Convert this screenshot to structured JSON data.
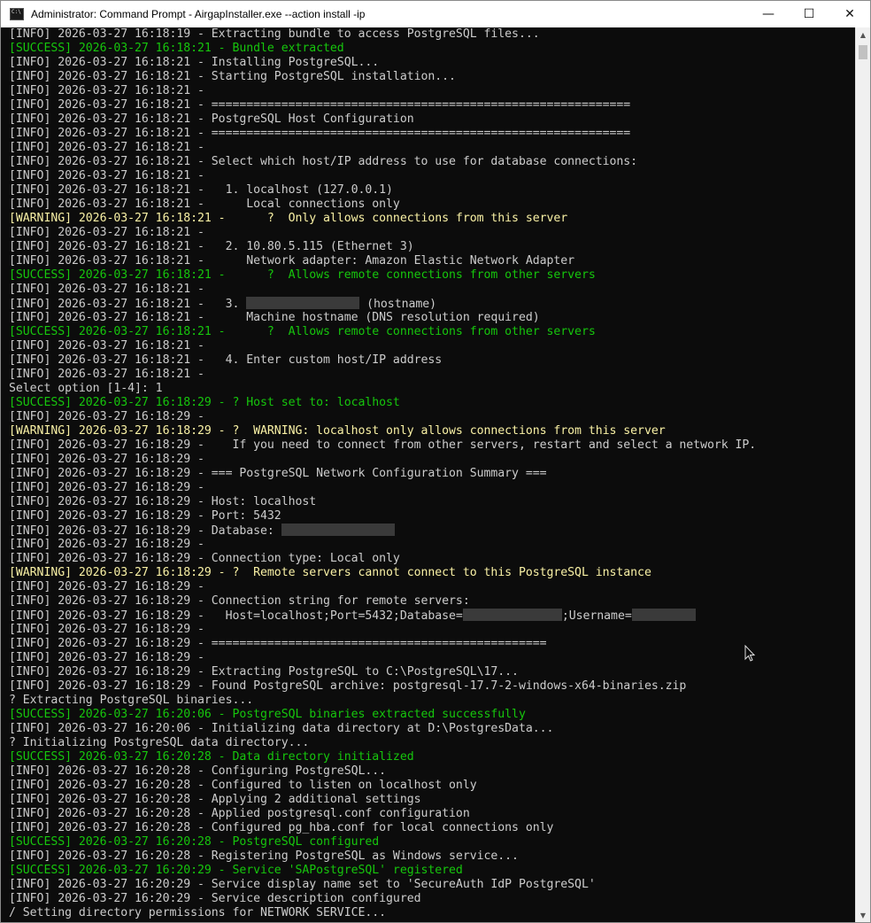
{
  "window": {
    "title": "Administrator: Command Prompt - AirgapInstaller.exe  --action install -ip",
    "controls": {
      "minimize": "—",
      "maximize": "☐",
      "close": "✕"
    }
  },
  "console": {
    "lines": [
      {
        "type": "info",
        "text": "[INFO] 2026-03-27 16:18:19 - Extracting bundle to access PostgreSQL files..."
      },
      {
        "type": "success",
        "text": "[SUCCESS] 2026-03-27 16:18:21 - Bundle extracted"
      },
      {
        "type": "info",
        "text": "[INFO] 2026-03-27 16:18:21 - Installing PostgreSQL..."
      },
      {
        "type": "info",
        "text": "[INFO] 2026-03-27 16:18:21 - Starting PostgreSQL installation..."
      },
      {
        "type": "info",
        "text": "[INFO] 2026-03-27 16:18:21 -"
      },
      {
        "type": "info",
        "text": "[INFO] 2026-03-27 16:18:21 - ============================================================"
      },
      {
        "type": "info",
        "text": "[INFO] 2026-03-27 16:18:21 - PostgreSQL Host Configuration"
      },
      {
        "type": "info",
        "text": "[INFO] 2026-03-27 16:18:21 - ============================================================"
      },
      {
        "type": "info",
        "text": "[INFO] 2026-03-27 16:18:21 -"
      },
      {
        "type": "info",
        "text": "[INFO] 2026-03-27 16:18:21 - Select which host/IP address to use for database connections:"
      },
      {
        "type": "info",
        "text": "[INFO] 2026-03-27 16:18:21 -"
      },
      {
        "type": "info",
        "text": "[INFO] 2026-03-27 16:18:21 -   1. localhost (127.0.0.1)"
      },
      {
        "type": "info",
        "text": "[INFO] 2026-03-27 16:18:21 -      Local connections only"
      },
      {
        "type": "warning",
        "text": "[WARNING] 2026-03-27 16:18:21 -      ?  Only allows connections from this server"
      },
      {
        "type": "info",
        "text": "[INFO] 2026-03-27 16:18:21 -"
      },
      {
        "type": "info",
        "text": "[INFO] 2026-03-27 16:18:21 -   2. 10.80.5.115 (Ethernet 3)"
      },
      {
        "type": "info",
        "text": "[INFO] 2026-03-27 16:18:21 -      Network adapter: Amazon Elastic Network Adapter"
      },
      {
        "type": "success",
        "text": "[SUCCESS] 2026-03-27 16:18:21 -      ?  Allows remote connections from other servers"
      },
      {
        "type": "info",
        "text": "[INFO] 2026-03-27 16:18:21 -"
      },
      {
        "type": "info",
        "text": "[INFO] 2026-03-27 16:18:21 -   3. ",
        "redact": 16,
        "after": " (hostname)"
      },
      {
        "type": "info",
        "text": "[INFO] 2026-03-27 16:18:21 -      Machine hostname (DNS resolution required)"
      },
      {
        "type": "success",
        "text": "[SUCCESS] 2026-03-27 16:18:21 -      ?  Allows remote connections from other servers"
      },
      {
        "type": "info",
        "text": "[INFO] 2026-03-27 16:18:21 -"
      },
      {
        "type": "info",
        "text": "[INFO] 2026-03-27 16:18:21 -   4. Enter custom host/IP address"
      },
      {
        "type": "info",
        "text": "[INFO] 2026-03-27 16:18:21 -"
      },
      {
        "type": "info",
        "text": "Select option [1-4]: 1"
      },
      {
        "type": "success",
        "text": "[SUCCESS] 2026-03-27 16:18:29 - ? Host set to: localhost"
      },
      {
        "type": "info",
        "text": "[INFO] 2026-03-27 16:18:29 -"
      },
      {
        "type": "warning",
        "text": "[WARNING] 2026-03-27 16:18:29 - ?  WARNING: localhost only allows connections from this server"
      },
      {
        "type": "info",
        "text": "[INFO] 2026-03-27 16:18:29 -    If you need to connect from other servers, restart and select a network IP."
      },
      {
        "type": "info",
        "text": "[INFO] 2026-03-27 16:18:29 -"
      },
      {
        "type": "info",
        "text": "[INFO] 2026-03-27 16:18:29 - === PostgreSQL Network Configuration Summary ==="
      },
      {
        "type": "info",
        "text": "[INFO] 2026-03-27 16:18:29 -"
      },
      {
        "type": "info",
        "text": "[INFO] 2026-03-27 16:18:29 - Host: localhost"
      },
      {
        "type": "info",
        "text": "[INFO] 2026-03-27 16:18:29 - Port: 5432"
      },
      {
        "type": "info",
        "text": "[INFO] 2026-03-27 16:18:29 - Database: ",
        "redact": 16,
        "after": ""
      },
      {
        "type": "info",
        "text": "[INFO] 2026-03-27 16:18:29 -"
      },
      {
        "type": "info",
        "text": "[INFO] 2026-03-27 16:18:29 - Connection type: Local only"
      },
      {
        "type": "warning",
        "text": "[WARNING] 2026-03-27 16:18:29 - ?  Remote servers cannot connect to this PostgreSQL instance"
      },
      {
        "type": "info",
        "text": "[INFO] 2026-03-27 16:18:29 -"
      },
      {
        "type": "info",
        "text": "[INFO] 2026-03-27 16:18:29 - Connection string for remote servers:"
      },
      {
        "type": "info",
        "text": "[INFO] 2026-03-27 16:18:29 -   Host=localhost;Port=5432;Database=",
        "redact": 14,
        "after": ";Username=",
        "redact2": 9
      },
      {
        "type": "info",
        "text": "[INFO] 2026-03-27 16:18:29 -"
      },
      {
        "type": "info",
        "text": "[INFO] 2026-03-27 16:18:29 - ================================================"
      },
      {
        "type": "info",
        "text": "[INFO] 2026-03-27 16:18:29 -"
      },
      {
        "type": "info",
        "text": "[INFO] 2026-03-27 16:18:29 - Extracting PostgreSQL to C:\\PostgreSQL\\17..."
      },
      {
        "type": "info",
        "text": "[INFO] 2026-03-27 16:18:29 - Found PostgreSQL archive: postgresql-17.7-2-windows-x64-binaries.zip"
      },
      {
        "type": "info",
        "text": "? Extracting PostgreSQL binaries..."
      },
      {
        "type": "success",
        "text": "[SUCCESS] 2026-03-27 16:20:06 - PostgreSQL binaries extracted successfully"
      },
      {
        "type": "info",
        "text": "[INFO] 2026-03-27 16:20:06 - Initializing data directory at D:\\PostgresData..."
      },
      {
        "type": "info",
        "text": "? Initializing PostgreSQL data directory..."
      },
      {
        "type": "success",
        "text": "[SUCCESS] 2026-03-27 16:20:28 - Data directory initialized"
      },
      {
        "type": "info",
        "text": "[INFO] 2026-03-27 16:20:28 - Configuring PostgreSQL..."
      },
      {
        "type": "info",
        "text": "[INFO] 2026-03-27 16:20:28 - Configured to listen on localhost only"
      },
      {
        "type": "info",
        "text": "[INFO] 2026-03-27 16:20:28 - Applying 2 additional settings"
      },
      {
        "type": "info",
        "text": "[INFO] 2026-03-27 16:20:28 - Applied postgresql.conf configuration"
      },
      {
        "type": "info",
        "text": "[INFO] 2026-03-27 16:20:28 - Configured pg_hba.conf for local connections only"
      },
      {
        "type": "success",
        "text": "[SUCCESS] 2026-03-27 16:20:28 - PostgreSQL configured"
      },
      {
        "type": "info",
        "text": "[INFO] 2026-03-27 16:20:28 - Registering PostgreSQL as Windows service..."
      },
      {
        "type": "success",
        "text": "[SUCCESS] 2026-03-27 16:20:29 - Service 'SAPostgreSQL' registered"
      },
      {
        "type": "info",
        "text": "[INFO] 2026-03-27 16:20:29 - Service display name set to 'SecureAuth IdP PostgreSQL'"
      },
      {
        "type": "info",
        "text": "[INFO] 2026-03-27 16:20:29 - Service description configured"
      },
      {
        "type": "info",
        "text": "/ Setting directory permissions for NETWORK SERVICE..."
      }
    ]
  },
  "colors": {
    "background": "#0c0c0c",
    "info": "#cccccc",
    "success": "#16c60c",
    "warning": "#f9f1a5"
  }
}
